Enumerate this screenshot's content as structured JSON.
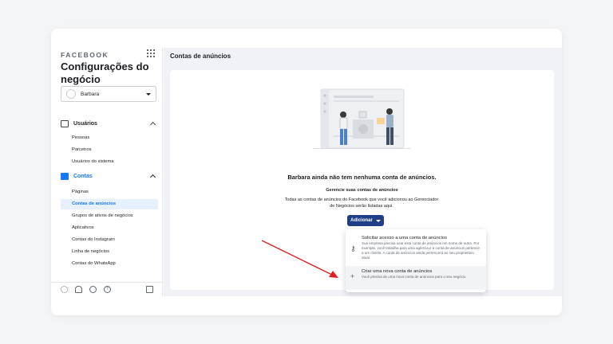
{
  "brand": "FACEBOOK",
  "app_title": "Configurações do negócio",
  "business": {
    "name": "Barbara"
  },
  "sidebar": {
    "users": {
      "label": "Usuários",
      "items": [
        "Pessoas",
        "Parceiros",
        "Usuários do sistema"
      ]
    },
    "accounts": {
      "label": "Contas",
      "items": [
        "Páginas",
        "Contas de anúncios",
        "Grupos de ativos de negócios",
        "Aplicativos",
        "Contas do Instagram",
        "Linha de negócios",
        "Contas do WhatsApp"
      ],
      "active_index": 1
    }
  },
  "main": {
    "title": "Contas de anúncios",
    "empty_title": "Barbara ainda não tem nenhuma conta de anúncios.",
    "empty_subtitle": "Gerencie suas contas de anúncios",
    "empty_description": "Todas as contas de anúncios do Facebook que você adicionou ao Gerenciador de Negócios serão listadas aqui.",
    "add_button": "Adicionar",
    "dropdown": [
      {
        "title": "Solicitar acesso a uma conta de anúncios",
        "description": "Sua empresa precisa usar esta conta de anúncios em nome de outra. Por exemplo, você trabalha para uma agência e a conta de anúncios pertence a um cliente. A conta de anúncios ainda pertencerá ao seu proprietário atual.",
        "icon": "key-icon"
      },
      {
        "title": "Criar uma nova conta de anúncios",
        "description": "Você precisa de uma nova conta de anúncios para o seu negócio.",
        "icon": "plus-icon"
      }
    ]
  },
  "colors": {
    "accent": "#1877f2",
    "button": "#1f3f88",
    "arrow": "#e02020"
  }
}
